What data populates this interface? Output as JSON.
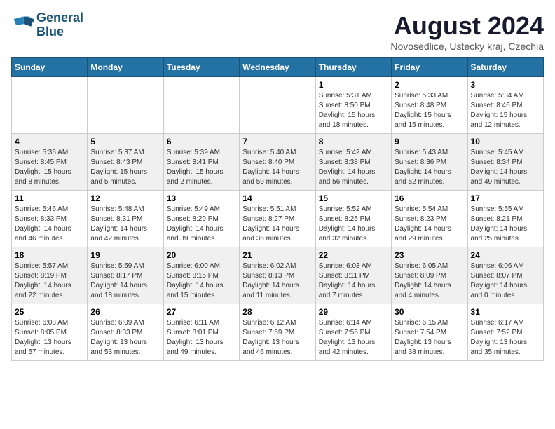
{
  "header": {
    "logo_line1": "General",
    "logo_line2": "Blue",
    "title": "August 2024",
    "subtitle": "Novosedlice, Ustecky kraj, Czechia"
  },
  "days_of_week": [
    "Sunday",
    "Monday",
    "Tuesday",
    "Wednesday",
    "Thursday",
    "Friday",
    "Saturday"
  ],
  "weeks": [
    [
      {
        "day": "",
        "sunrise": "",
        "sunset": "",
        "daylight": ""
      },
      {
        "day": "",
        "sunrise": "",
        "sunset": "",
        "daylight": ""
      },
      {
        "day": "",
        "sunrise": "",
        "sunset": "",
        "daylight": ""
      },
      {
        "day": "",
        "sunrise": "",
        "sunset": "",
        "daylight": ""
      },
      {
        "day": "1",
        "sunrise": "Sunrise: 5:31 AM",
        "sunset": "Sunset: 8:50 PM",
        "daylight": "Daylight: 15 hours and 18 minutes."
      },
      {
        "day": "2",
        "sunrise": "Sunrise: 5:33 AM",
        "sunset": "Sunset: 8:48 PM",
        "daylight": "Daylight: 15 hours and 15 minutes."
      },
      {
        "day": "3",
        "sunrise": "Sunrise: 5:34 AM",
        "sunset": "Sunset: 8:46 PM",
        "daylight": "Daylight: 15 hours and 12 minutes."
      }
    ],
    [
      {
        "day": "4",
        "sunrise": "Sunrise: 5:36 AM",
        "sunset": "Sunset: 8:45 PM",
        "daylight": "Daylight: 15 hours and 8 minutes."
      },
      {
        "day": "5",
        "sunrise": "Sunrise: 5:37 AM",
        "sunset": "Sunset: 8:43 PM",
        "daylight": "Daylight: 15 hours and 5 minutes."
      },
      {
        "day": "6",
        "sunrise": "Sunrise: 5:39 AM",
        "sunset": "Sunset: 8:41 PM",
        "daylight": "Daylight: 15 hours and 2 minutes."
      },
      {
        "day": "7",
        "sunrise": "Sunrise: 5:40 AM",
        "sunset": "Sunset: 8:40 PM",
        "daylight": "Daylight: 14 hours and 59 minutes."
      },
      {
        "day": "8",
        "sunrise": "Sunrise: 5:42 AM",
        "sunset": "Sunset: 8:38 PM",
        "daylight": "Daylight: 14 hours and 56 minutes."
      },
      {
        "day": "9",
        "sunrise": "Sunrise: 5:43 AM",
        "sunset": "Sunset: 8:36 PM",
        "daylight": "Daylight: 14 hours and 52 minutes."
      },
      {
        "day": "10",
        "sunrise": "Sunrise: 5:45 AM",
        "sunset": "Sunset: 8:34 PM",
        "daylight": "Daylight: 14 hours and 49 minutes."
      }
    ],
    [
      {
        "day": "11",
        "sunrise": "Sunrise: 5:46 AM",
        "sunset": "Sunset: 8:33 PM",
        "daylight": "Daylight: 14 hours and 46 minutes."
      },
      {
        "day": "12",
        "sunrise": "Sunrise: 5:48 AM",
        "sunset": "Sunset: 8:31 PM",
        "daylight": "Daylight: 14 hours and 42 minutes."
      },
      {
        "day": "13",
        "sunrise": "Sunrise: 5:49 AM",
        "sunset": "Sunset: 8:29 PM",
        "daylight": "Daylight: 14 hours and 39 minutes."
      },
      {
        "day": "14",
        "sunrise": "Sunrise: 5:51 AM",
        "sunset": "Sunset: 8:27 PM",
        "daylight": "Daylight: 14 hours and 36 minutes."
      },
      {
        "day": "15",
        "sunrise": "Sunrise: 5:52 AM",
        "sunset": "Sunset: 8:25 PM",
        "daylight": "Daylight: 14 hours and 32 minutes."
      },
      {
        "day": "16",
        "sunrise": "Sunrise: 5:54 AM",
        "sunset": "Sunset: 8:23 PM",
        "daylight": "Daylight: 14 hours and 29 minutes."
      },
      {
        "day": "17",
        "sunrise": "Sunrise: 5:55 AM",
        "sunset": "Sunset: 8:21 PM",
        "daylight": "Daylight: 14 hours and 25 minutes."
      }
    ],
    [
      {
        "day": "18",
        "sunrise": "Sunrise: 5:57 AM",
        "sunset": "Sunset: 8:19 PM",
        "daylight": "Daylight: 14 hours and 22 minutes."
      },
      {
        "day": "19",
        "sunrise": "Sunrise: 5:59 AM",
        "sunset": "Sunset: 8:17 PM",
        "daylight": "Daylight: 14 hours and 18 minutes."
      },
      {
        "day": "20",
        "sunrise": "Sunrise: 6:00 AM",
        "sunset": "Sunset: 8:15 PM",
        "daylight": "Daylight: 14 hours and 15 minutes."
      },
      {
        "day": "21",
        "sunrise": "Sunrise: 6:02 AM",
        "sunset": "Sunset: 8:13 PM",
        "daylight": "Daylight: 14 hours and 11 minutes."
      },
      {
        "day": "22",
        "sunrise": "Sunrise: 6:03 AM",
        "sunset": "Sunset: 8:11 PM",
        "daylight": "Daylight: 14 hours and 7 minutes."
      },
      {
        "day": "23",
        "sunrise": "Sunrise: 6:05 AM",
        "sunset": "Sunset: 8:09 PM",
        "daylight": "Daylight: 14 hours and 4 minutes."
      },
      {
        "day": "24",
        "sunrise": "Sunrise: 6:06 AM",
        "sunset": "Sunset: 8:07 PM",
        "daylight": "Daylight: 14 hours and 0 minutes."
      }
    ],
    [
      {
        "day": "25",
        "sunrise": "Sunrise: 6:08 AM",
        "sunset": "Sunset: 8:05 PM",
        "daylight": "Daylight: 13 hours and 57 minutes."
      },
      {
        "day": "26",
        "sunrise": "Sunrise: 6:09 AM",
        "sunset": "Sunset: 8:03 PM",
        "daylight": "Daylight: 13 hours and 53 minutes."
      },
      {
        "day": "27",
        "sunrise": "Sunrise: 6:11 AM",
        "sunset": "Sunset: 8:01 PM",
        "daylight": "Daylight: 13 hours and 49 minutes."
      },
      {
        "day": "28",
        "sunrise": "Sunrise: 6:12 AM",
        "sunset": "Sunset: 7:59 PM",
        "daylight": "Daylight: 13 hours and 46 minutes."
      },
      {
        "day": "29",
        "sunrise": "Sunrise: 6:14 AM",
        "sunset": "Sunset: 7:56 PM",
        "daylight": "Daylight: 13 hours and 42 minutes."
      },
      {
        "day": "30",
        "sunrise": "Sunrise: 6:15 AM",
        "sunset": "Sunset: 7:54 PM",
        "daylight": "Daylight: 13 hours and 38 minutes."
      },
      {
        "day": "31",
        "sunrise": "Sunrise: 6:17 AM",
        "sunset": "Sunset: 7:52 PM",
        "daylight": "Daylight: 13 hours and 35 minutes."
      }
    ]
  ]
}
